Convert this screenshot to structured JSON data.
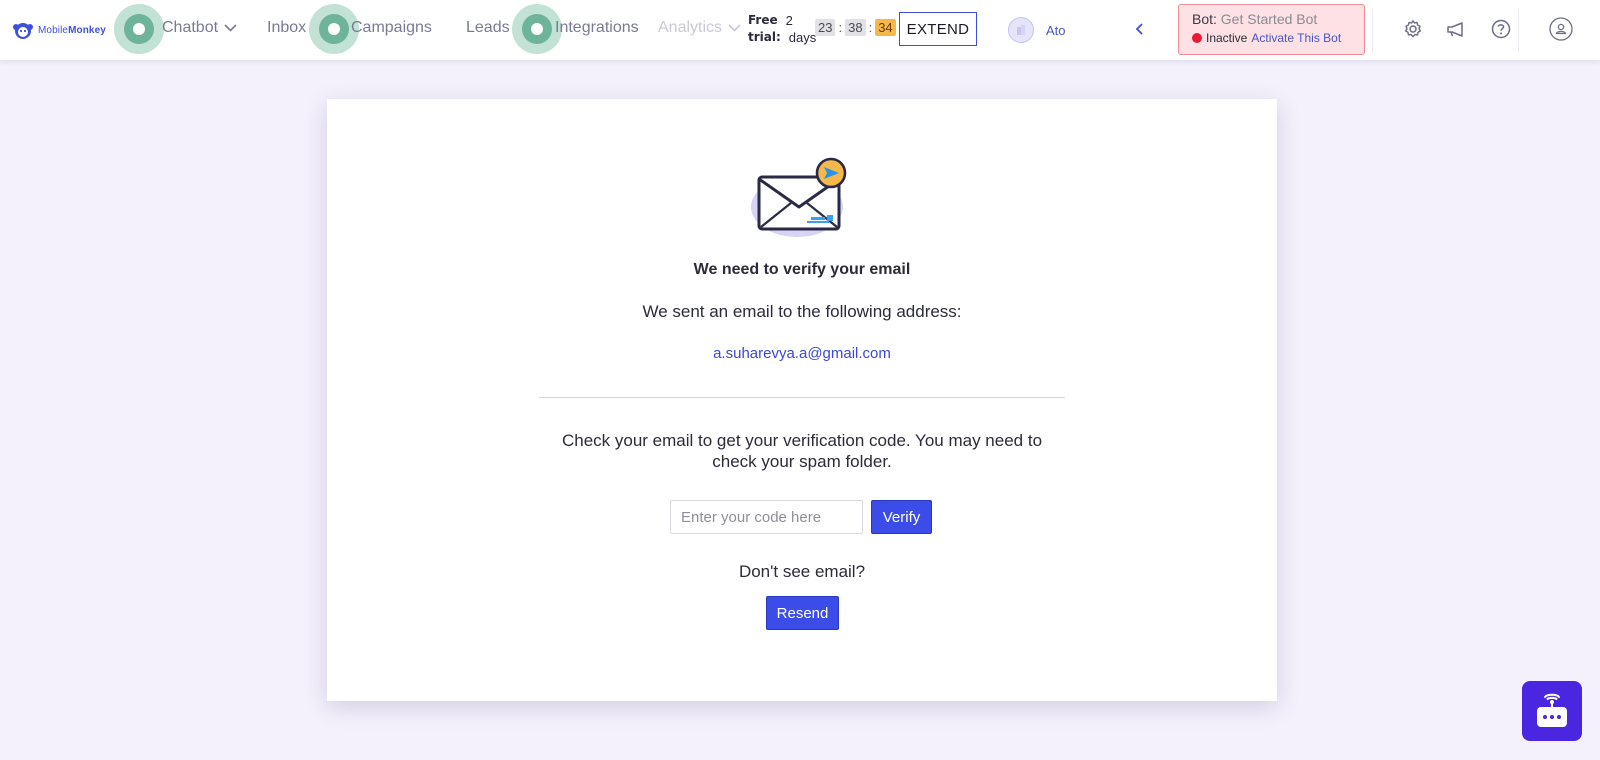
{
  "brand": {
    "name_part1": "Mobile",
    "name_part2": "Monkey",
    "accent": "#3f51d8"
  },
  "nav": {
    "chatbot": "Chatbot",
    "inbox": "Inbox",
    "campaigns": "Campaigns",
    "leads": "Leads",
    "integrations": "Integrations",
    "analytics": "Analytics"
  },
  "trial": {
    "label1": "Free",
    "label2": "trial:",
    "count": "2",
    "unit": "days",
    "hours": "23",
    "minutes": "38",
    "seconds": "34",
    "extend": "EXTEND"
  },
  "user": {
    "name": "Ato"
  },
  "bot": {
    "key": "Bot:",
    "name": "Get Started Bot",
    "status": "Inactive",
    "activate": "Activate This Bot",
    "status_color": "#e81a35"
  },
  "header_icons": [
    "gear-icon",
    "megaphone-icon",
    "help-icon",
    "user-icon"
  ],
  "verify": {
    "heading": "We need to verify your email",
    "sent": "We sent an email to the following address:",
    "email": "a.suharevya.a@gmail.com",
    "instructions": "Check your email to get your verification code. You may need to check your spam folder.",
    "code_placeholder": "Enter your code here",
    "verify_button": "Verify",
    "dont_see": "Don't see email?",
    "resend_button": "Resend",
    "button_color": "#3b4ce8"
  }
}
